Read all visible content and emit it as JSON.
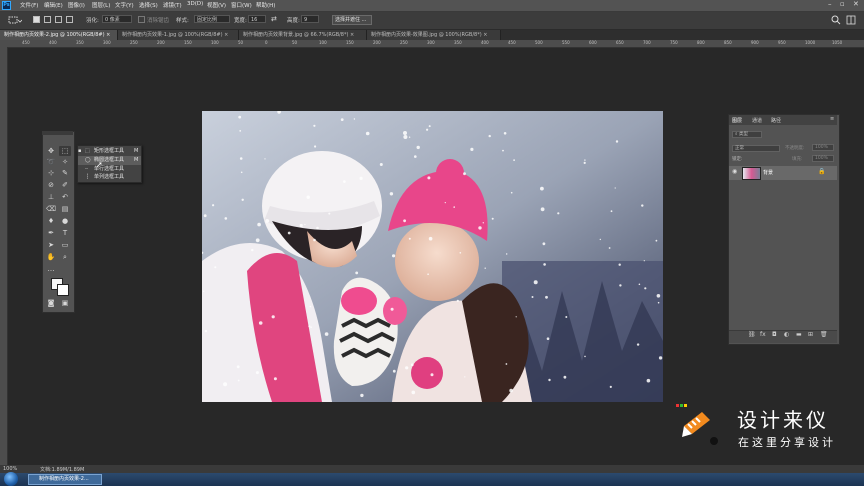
{
  "menu": {
    "app_icon": "Ps",
    "items": [
      "文件(F)",
      "编辑(E)",
      "图像(I)",
      "图层(L)",
      "文字(Y)",
      "选择(S)",
      "滤镜(T)",
      "3D(D)",
      "视图(V)",
      "窗口(W)",
      "帮助(H)"
    ]
  },
  "options": {
    "feather_label": "羽化:",
    "feather_value": "0 像素",
    "antialias_label": "消除锯齿",
    "style_label": "样式:",
    "style_value": "固定比例",
    "width_label": "宽度:",
    "width_value": "16",
    "height_label": "高度:",
    "height_value": "9",
    "select_mask_label": "选择并遮住 ..."
  },
  "tabs": [
    {
      "label": "制作相册内页效果-2.jpg @ 100%(RGB/8#)",
      "active": true
    },
    {
      "label": "制作相册内页效果-1.jpg @ 100%(RGB/8#)",
      "active": false
    },
    {
      "label": "制作相册内页效果背景.jpg @ 66.7%(RGB/8*)",
      "active": false
    },
    {
      "label": "制作相册内页效果-效果图.jpg @ 100%(RGB/8*)",
      "active": false
    }
  ],
  "ruler_ticks": [
    "450",
    "400",
    "350",
    "300",
    "250",
    "200",
    "150",
    "100",
    "50",
    "0",
    "50",
    "100",
    "150",
    "200",
    "250",
    "300",
    "350",
    "400",
    "450",
    "500",
    "550",
    "600",
    "650",
    "700",
    "750",
    "800",
    "850",
    "900",
    "950",
    "1000",
    "1050"
  ],
  "flyout": {
    "items": [
      {
        "label": "矩形选框工具",
        "key": "M"
      },
      {
        "label": "椭圆选框工具",
        "key": "M"
      },
      {
        "label": "单行选框工具",
        "key": ""
      },
      {
        "label": "单列选框工具",
        "key": ""
      }
    ]
  },
  "layers_panel": {
    "tabs": [
      "图层",
      "通道",
      "路径"
    ],
    "blend_mode": "正常",
    "opacity_label": "不透明度:",
    "opacity_value": "100%",
    "lock_label": "锁定:",
    "fill_label": "填充:",
    "fill_value": "100%",
    "layer_name": "背景"
  },
  "status": {
    "zoom": "100%",
    "doc_info": "文档:1.89M/1.89M"
  },
  "taskbar": {
    "app_label": "制作相册内页效果-2..."
  },
  "watermark": {
    "title": "设计来仪",
    "subtitle": "在这里分享设计"
  },
  "colors": {
    "accent": "#31a8ff",
    "menubar": "#535353",
    "workspace": "#282828",
    "panel": "#535353"
  }
}
